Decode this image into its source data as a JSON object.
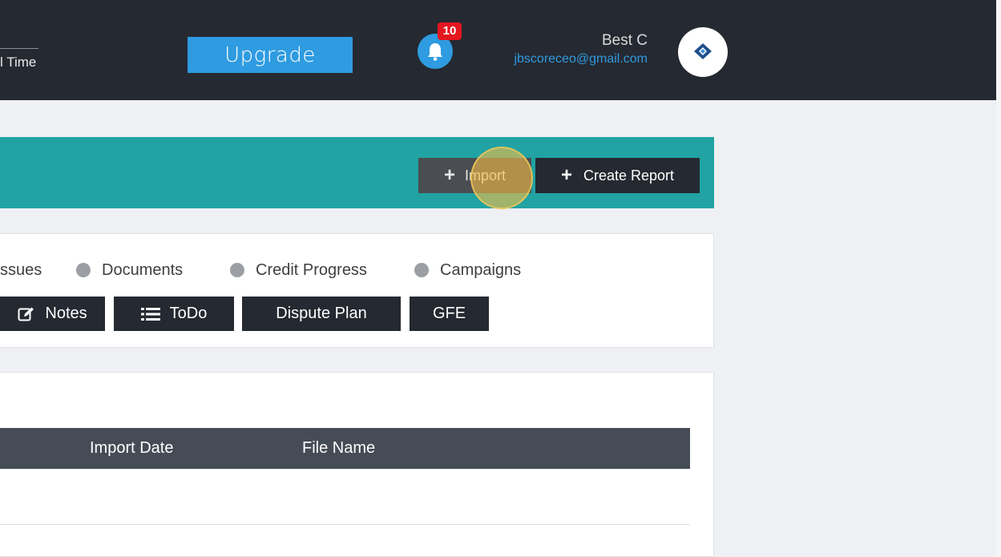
{
  "header": {
    "time_label": "l Time",
    "upgrade_label": "Upgrade",
    "notification_count": "10",
    "user_name": "Best C",
    "user_email": "jbscoreceo@gmail.com"
  },
  "actions": {
    "import_label": "Import",
    "create_report_label": "Create Report"
  },
  "tabs": {
    "issues_label": "ssues",
    "documents_label": "Documents",
    "credit_progress_label": "Credit Progress",
    "campaigns_label": "Campaigns"
  },
  "buttons": {
    "notes_label": "Notes",
    "todo_label": "ToDo",
    "dispute_plan_label": "Dispute Plan",
    "gfe_label": "GFE"
  },
  "table": {
    "columns": [
      "Import Date",
      "File Name"
    ]
  },
  "colors": {
    "teal": "#21a3a3",
    "dark": "#252931",
    "accent": "#2f9be0",
    "badge": "#e3171f"
  },
  "icons": {
    "bell": "bell-icon",
    "plus": "plus-icon",
    "edit": "edit-icon",
    "list": "list-icon"
  }
}
